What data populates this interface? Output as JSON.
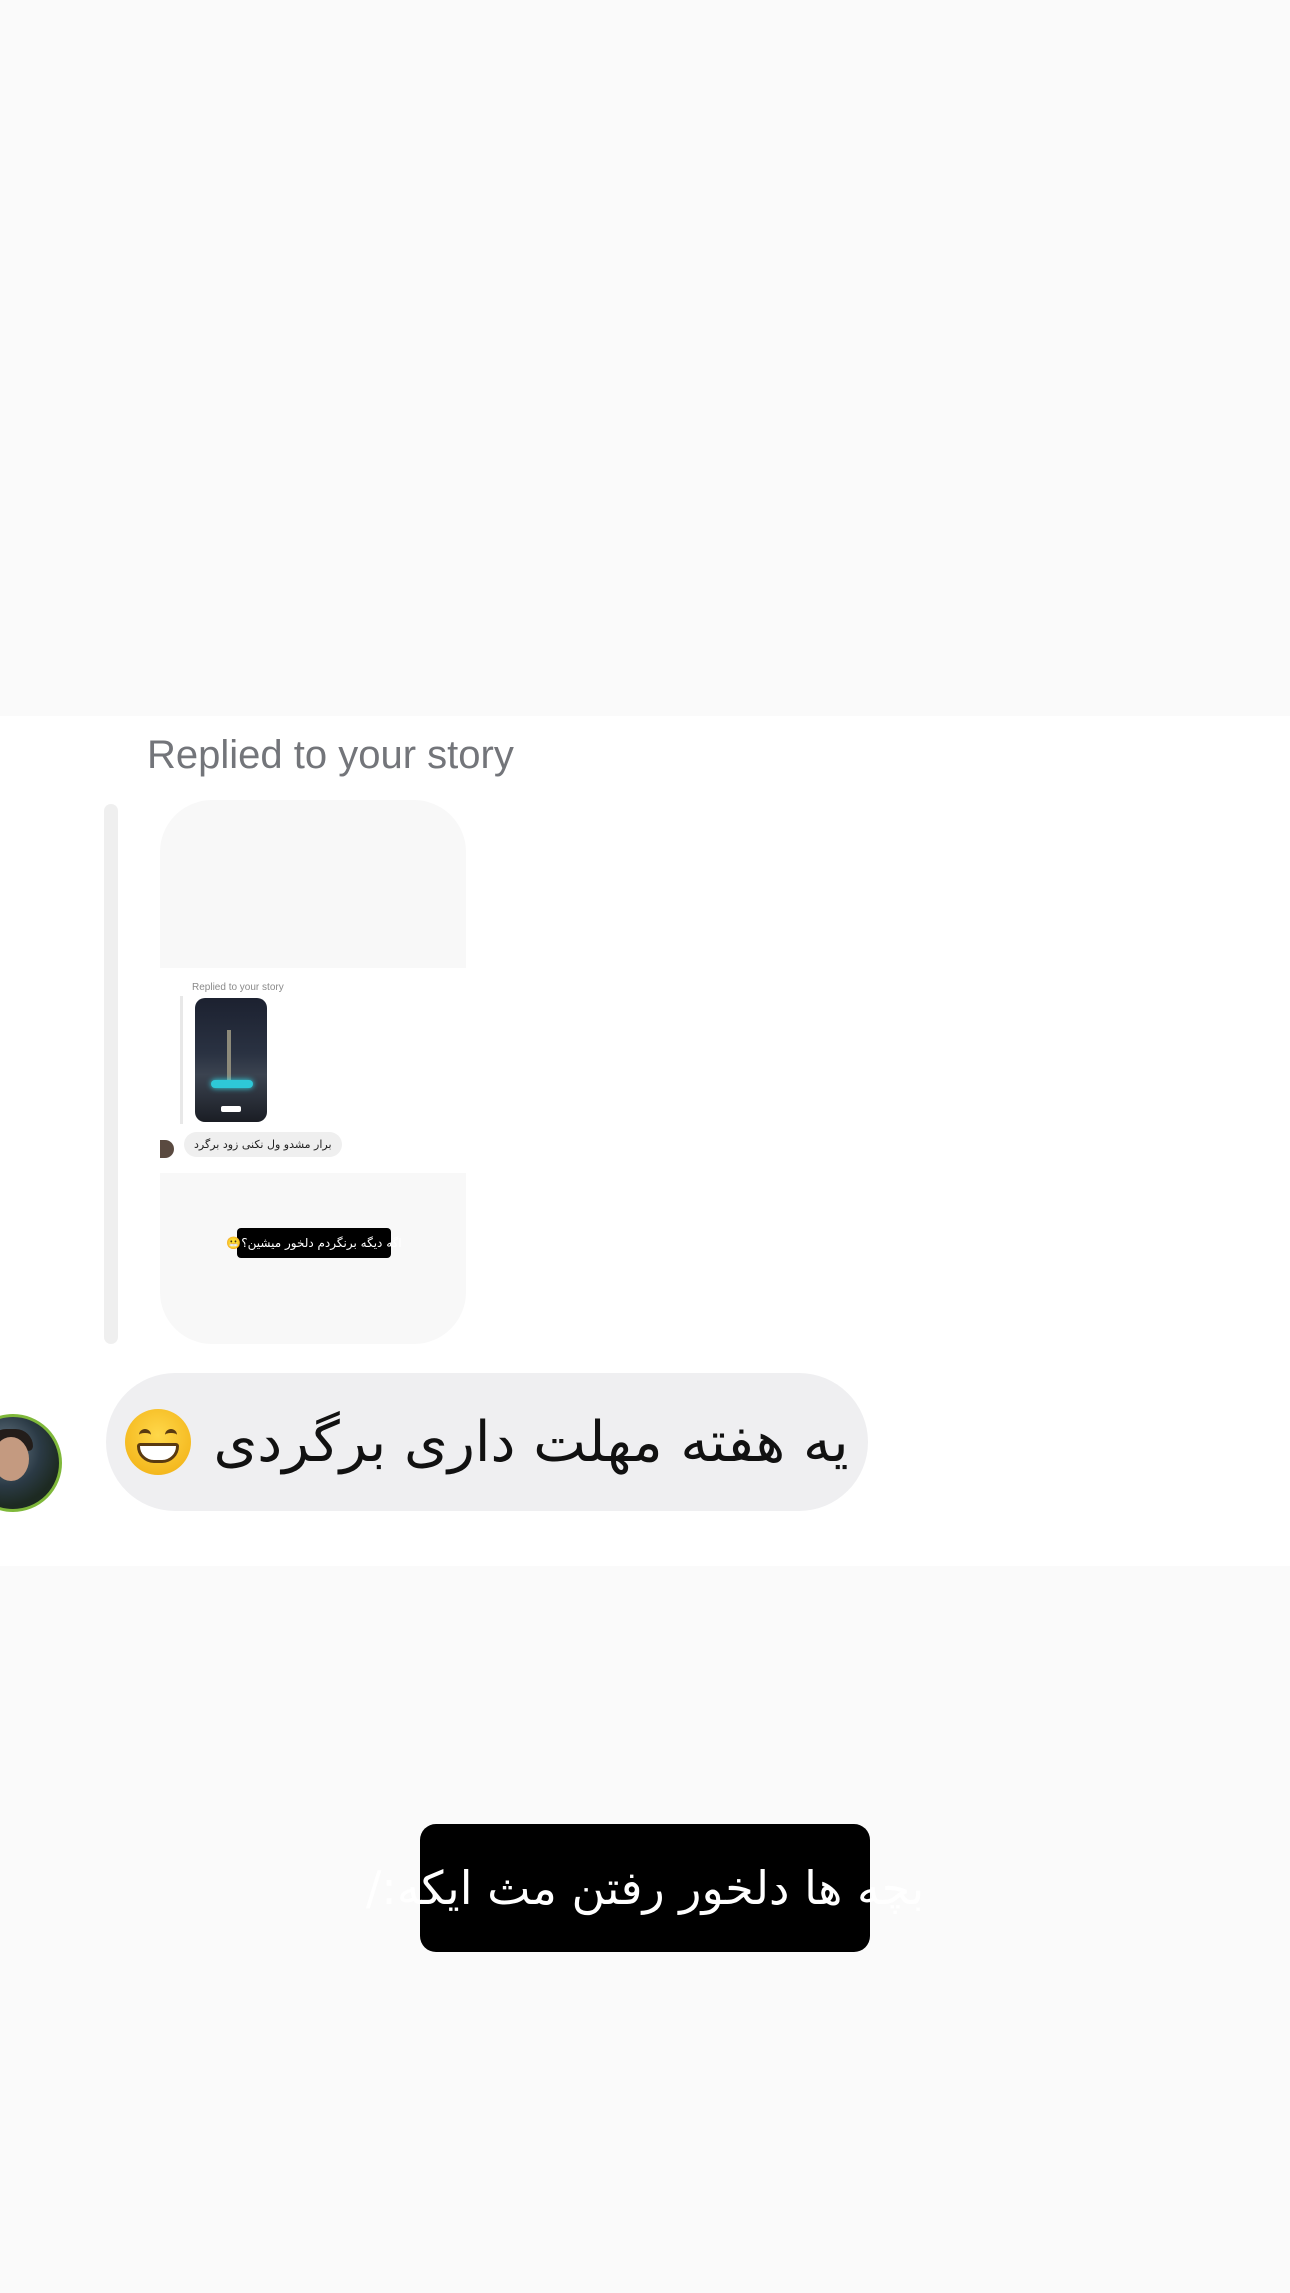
{
  "reply_header": {
    "label": "Replied to your story"
  },
  "story_preview": {
    "replied_label": "Replied to your story",
    "reply_message": "برار مشدو ول نکنی زود برگرد",
    "story_caption": "اگه دیگه برنگردم دلخور میشین؟😬"
  },
  "message": {
    "text": "یه هفته مهلت داری برگردی",
    "emoji_icon": "grinning-face-with-smiling-eyes-icon"
  },
  "story_overlay": {
    "text": "بچه ها دلخور رفتن مث ایکه:/"
  },
  "colors": {
    "background": "#fafafa",
    "chat_background": "#ffffff",
    "bubble": "#efeff1",
    "overlay": "#000000",
    "muted_text": "#73757a"
  }
}
